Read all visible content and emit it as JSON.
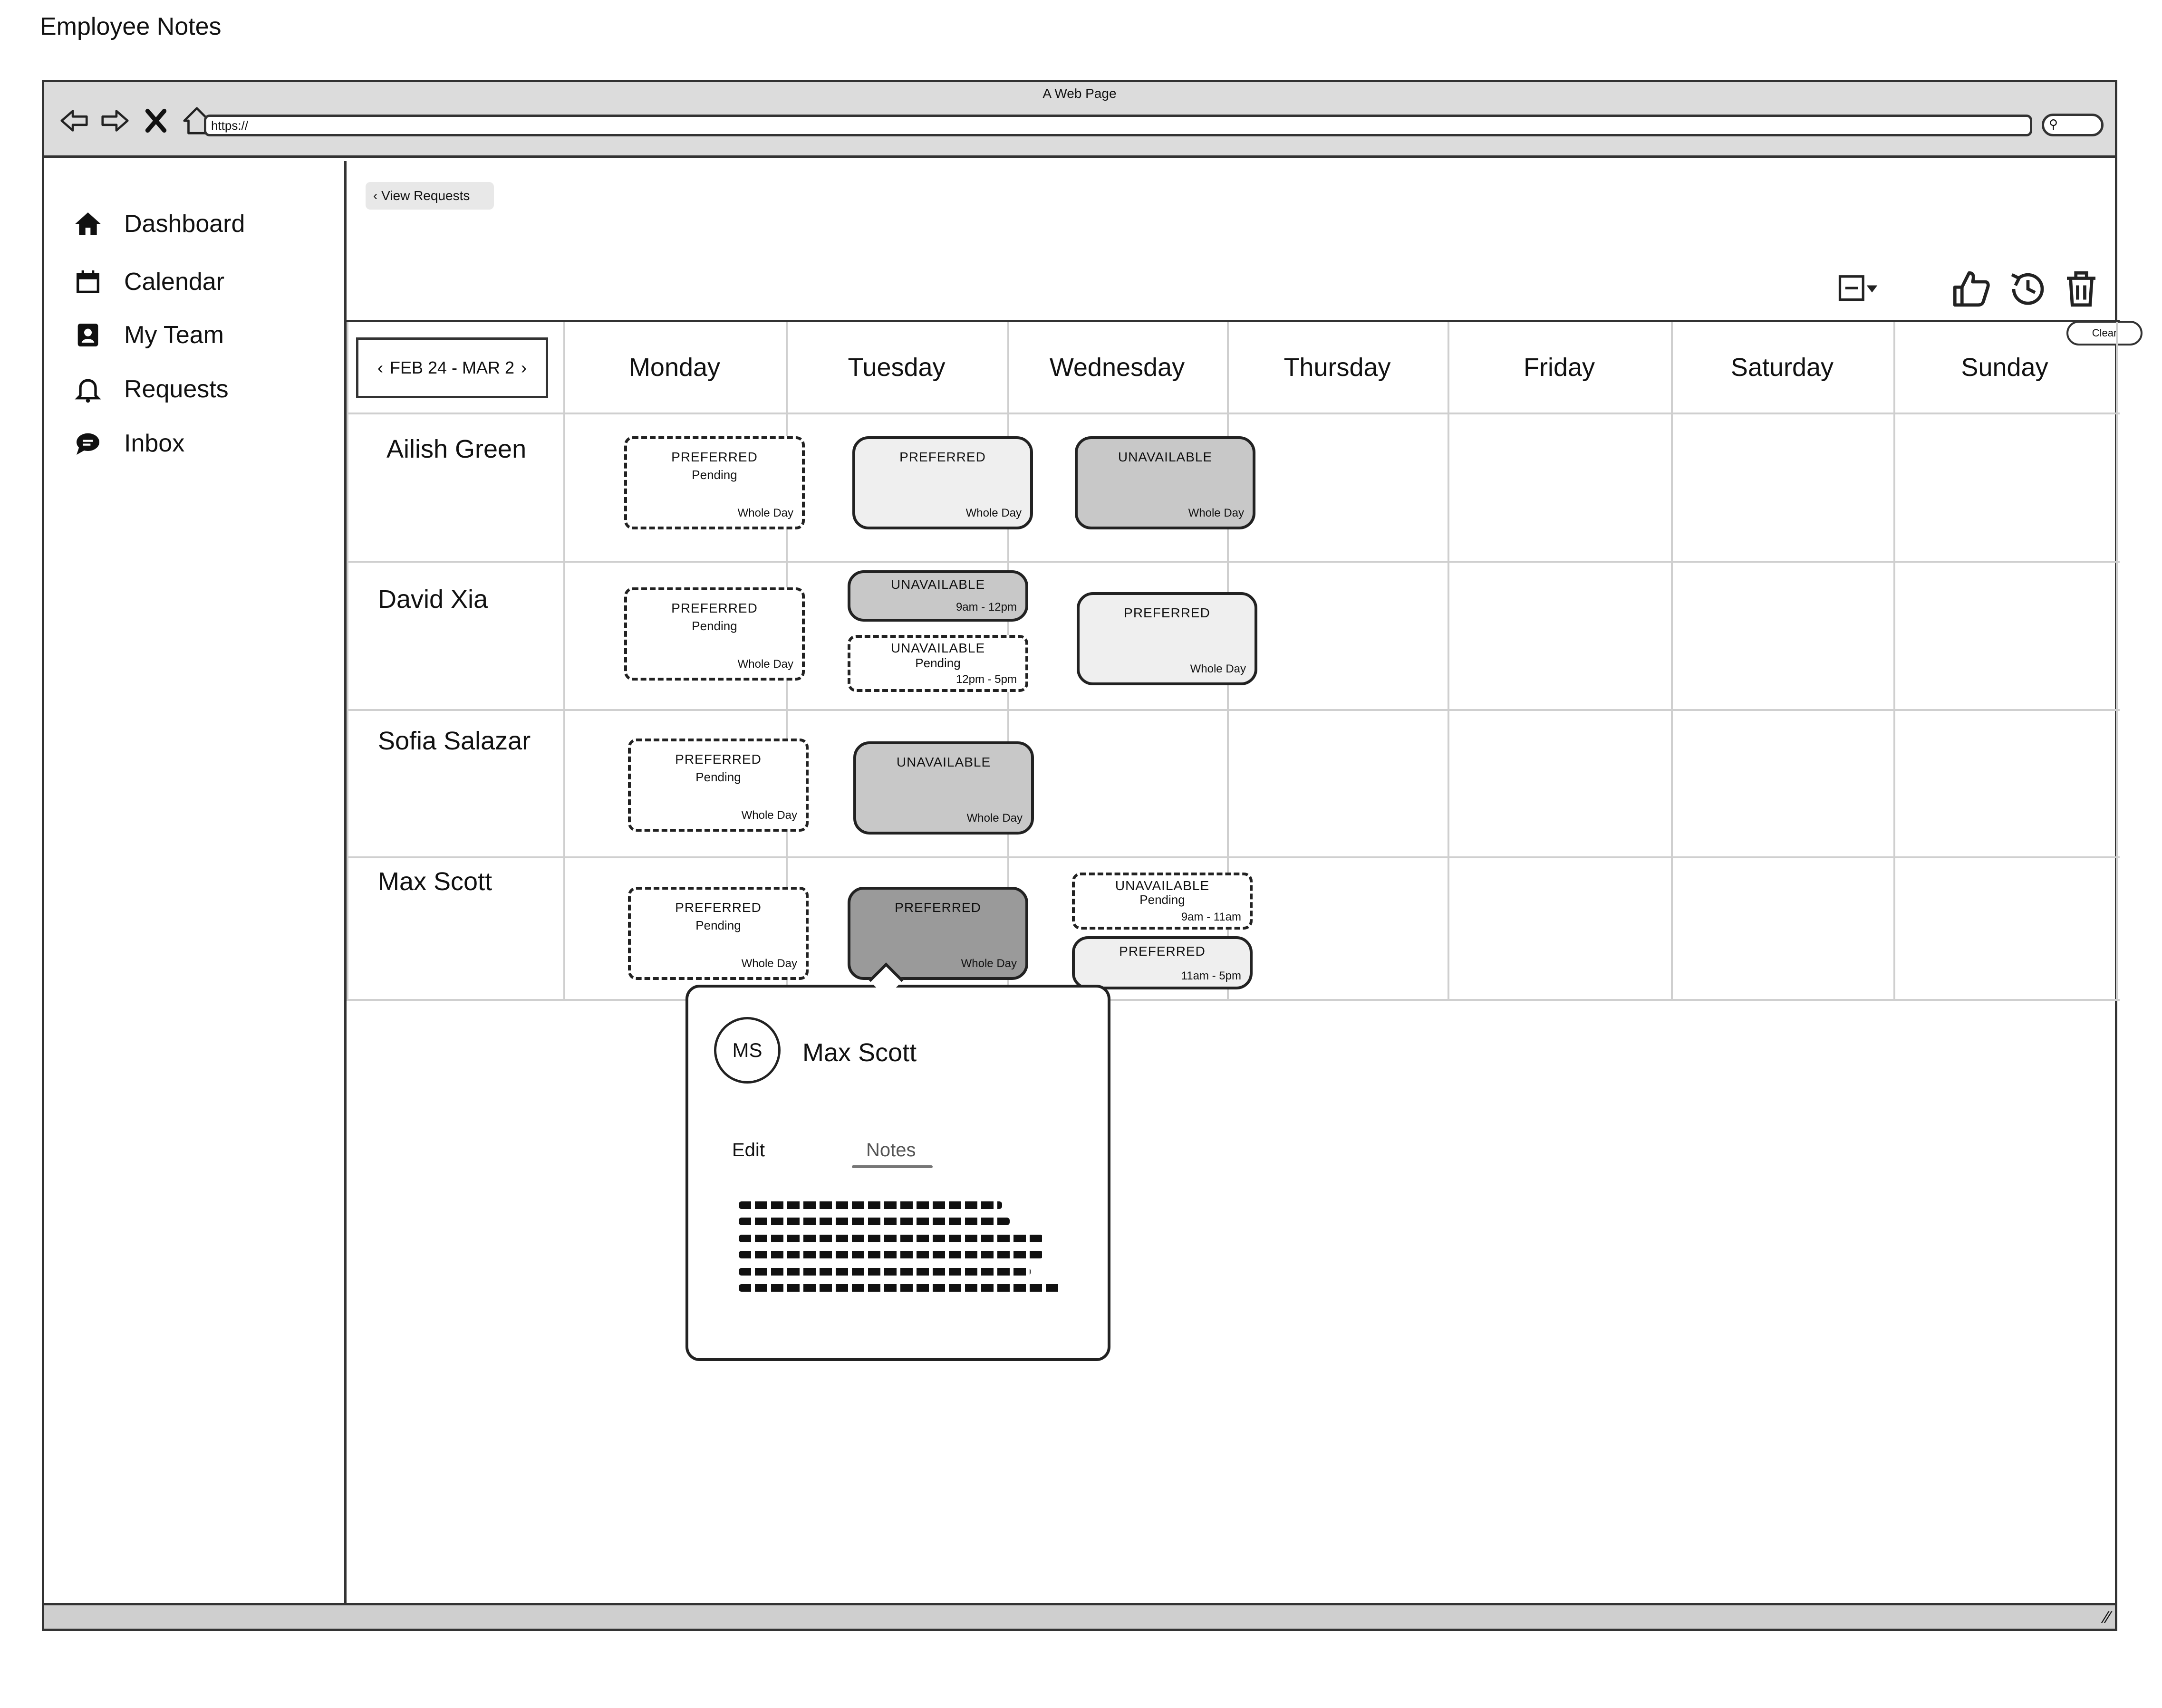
{
  "page_title": "Employee Notes",
  "browser": {
    "window_title": "A Web Page",
    "url": "https://"
  },
  "sidebar": {
    "items": [
      {
        "label": "Dashboard",
        "icon": "home-icon"
      },
      {
        "label": "Calendar",
        "icon": "calendar-icon"
      },
      {
        "label": "My Team",
        "icon": "team-icon"
      },
      {
        "label": "Requests",
        "icon": "bell-icon"
      },
      {
        "label": "Inbox",
        "icon": "chat-icon"
      }
    ]
  },
  "back_button": {
    "label": "View Requests"
  },
  "toolbar": {
    "tooltip": "Clear",
    "icons": [
      "view-select-icon",
      "thumbs-up-icon",
      "history-icon",
      "trash-icon"
    ]
  },
  "schedule": {
    "date_range": "FEB 24 - MAR 2",
    "days": [
      "Monday",
      "Tuesday",
      "Wednesday",
      "Thursday",
      "Friday",
      "Saturday",
      "Sunday"
    ],
    "employees": [
      "Ailish Green",
      "David Xia",
      "Sofia Salazar",
      "Max Scott"
    ],
    "cards": [
      {
        "employee": "Ailish Green",
        "day": "Monday",
        "type": "PREFERRED",
        "status": "Pending",
        "time": "Whole Day",
        "style": "dashed"
      },
      {
        "employee": "Ailish Green",
        "day": "Tuesday",
        "type": "PREFERRED",
        "status": "",
        "time": "Whole Day",
        "style": "light"
      },
      {
        "employee": "Ailish Green",
        "day": "Wednesday",
        "type": "UNAVAILABLE",
        "status": "",
        "time": "Whole Day",
        "style": "medium"
      },
      {
        "employee": "David Xia",
        "day": "Monday",
        "type": "PREFERRED",
        "status": "Pending",
        "time": "Whole Day",
        "style": "dashed"
      },
      {
        "employee": "David Xia",
        "day": "Tuesday",
        "type": "UNAVAILABLE",
        "status": "",
        "time": "9am - 12pm",
        "style": "medium"
      },
      {
        "employee": "David Xia",
        "day": "Tuesday",
        "type": "UNAVAILABLE",
        "status": "Pending",
        "time": "12pm - 5pm",
        "style": "dashed"
      },
      {
        "employee": "David Xia",
        "day": "Wednesday",
        "type": "PREFERRED",
        "status": "",
        "time": "Whole Day",
        "style": "light"
      },
      {
        "employee": "Sofia Salazar",
        "day": "Monday",
        "type": "PREFERRED",
        "status": "Pending",
        "time": "Whole Day",
        "style": "dashed"
      },
      {
        "employee": "Sofia Salazar",
        "day": "Tuesday",
        "type": "UNAVAILABLE",
        "status": "",
        "time": "Whole Day",
        "style": "medium"
      },
      {
        "employee": "Max Scott",
        "day": "Monday",
        "type": "PREFERRED",
        "status": "Pending",
        "time": "Whole Day",
        "style": "dashed"
      },
      {
        "employee": "Max Scott",
        "day": "Tuesday",
        "type": "PREFERRED",
        "status": "",
        "time": "Whole Day",
        "style": "dark"
      },
      {
        "employee": "Max Scott",
        "day": "Wednesday",
        "type": "UNAVAILABLE",
        "status": "Pending",
        "time": "9am - 11am",
        "style": "dashed"
      },
      {
        "employee": "Max Scott",
        "day": "Wednesday",
        "type": "PREFERRED",
        "status": "",
        "time": "11am - 5pm",
        "style": "light"
      }
    ]
  },
  "popover": {
    "initials": "MS",
    "name": "Max Scott",
    "tabs": [
      "Edit",
      "Notes"
    ],
    "active_tab": "Notes"
  }
}
